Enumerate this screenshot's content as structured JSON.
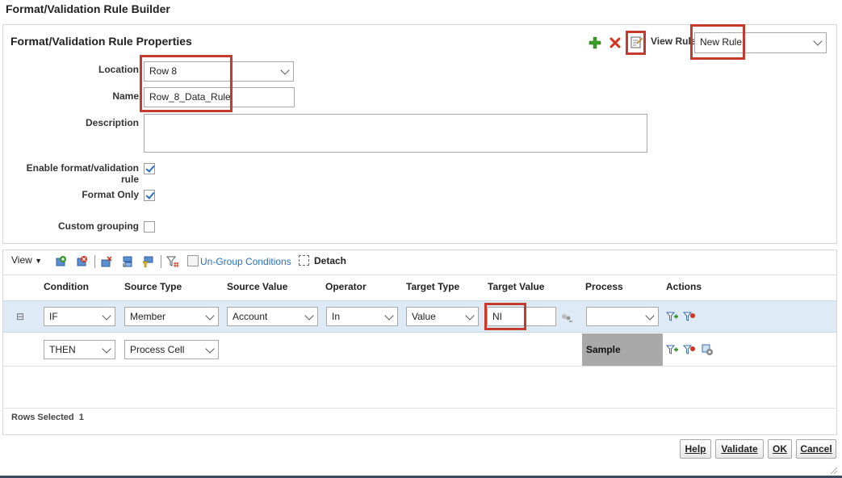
{
  "dialog": {
    "title": "Format/Validation Rule Builder"
  },
  "properties": {
    "title": "Format/Validation Rule Properties",
    "view_rule_label": "View Rule",
    "view_rule_value": "New Rule",
    "location_label": "Location",
    "location_value": "Row 8",
    "name_label": "Name",
    "name_value": "Row_8_Data_Rule",
    "description_label": "Description",
    "description_value": "",
    "enable_label": "Enable format/validation rule",
    "enable_checked": true,
    "format_only_label": "Format Only",
    "format_only_checked": true,
    "custom_grouping_label": "Custom grouping",
    "custom_grouping_checked": false
  },
  "toolbar": {
    "view_label": "View",
    "ungroup_label": "Un-Group Conditions",
    "detach_label": "Detach"
  },
  "table": {
    "headers": {
      "condition": "Condition",
      "source_type": "Source Type",
      "source_value": "Source Value",
      "operator": "Operator",
      "target_type": "Target Type",
      "target_value": "Target Value",
      "process": "Process",
      "actions": "Actions"
    },
    "rows": [
      {
        "expand": "⊟",
        "condition": "IF",
        "source_type": "Member",
        "source_value": "Account",
        "operator": "In",
        "target_type": "Value",
        "target_value": "NI",
        "process": ""
      },
      {
        "condition": "THEN",
        "source_type": "Process Cell",
        "process": "Sample"
      }
    ],
    "rows_selected_label": "Rows Selected",
    "rows_selected_value": "1"
  },
  "buttons": {
    "help": "Help",
    "validate": "Validate",
    "ok": "OK",
    "cancel": "Cancel"
  },
  "colors": {
    "accent": "#2a6fbf",
    "highlight": "#c43a2d",
    "row_selected": "#dfeaf7",
    "sample_bg": "#a9a9a9"
  }
}
